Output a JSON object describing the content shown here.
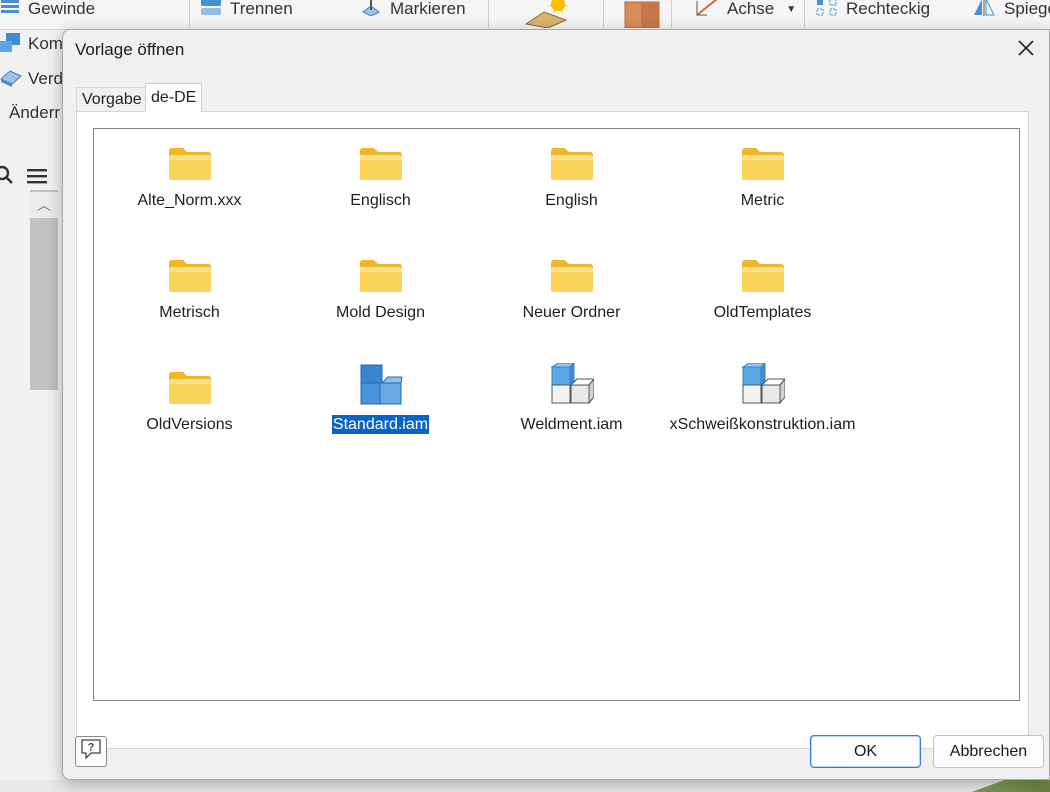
{
  "ribbon": {
    "items": [
      {
        "label": "Gewinde",
        "icon": "thread-icon"
      },
      {
        "label": "Trennen",
        "icon": "split-icon"
      },
      {
        "label": "Markieren",
        "icon": "mark-icon"
      },
      {
        "label": "",
        "icon": "sketch-icon"
      },
      {
        "label": "",
        "icon": "box-icon"
      },
      {
        "label": "Achse",
        "icon": "axis-icon"
      },
      {
        "label": "Rechteckig",
        "icon": "rectangular-pattern-icon"
      },
      {
        "label": "Spiege",
        "icon": "mirror-icon"
      }
    ]
  },
  "left_panel": {
    "items": [
      {
        "label": "Kom",
        "icon": "component-icon"
      },
      {
        "label": "Verd",
        "icon": "thicken-icon"
      },
      {
        "label": "Änderr",
        "icon": ""
      }
    ]
  },
  "dialog": {
    "title": "Vorlage öffnen",
    "tabs": [
      {
        "label": "Vorgabe",
        "active": false
      },
      {
        "label": "de-DE",
        "active": true
      }
    ],
    "files": [
      {
        "name": "Alte_Norm.xxx",
        "type": "folder",
        "selected": false
      },
      {
        "name": "Englisch",
        "type": "folder",
        "selected": false
      },
      {
        "name": "English",
        "type": "folder",
        "selected": false
      },
      {
        "name": "Metric",
        "type": "folder",
        "selected": false
      },
      {
        "name": "Metrisch",
        "type": "folder",
        "selected": false
      },
      {
        "name": "Mold Design",
        "type": "folder",
        "selected": false
      },
      {
        "name": "Neuer Ordner",
        "type": "folder",
        "selected": false
      },
      {
        "name": "OldTemplates",
        "type": "folder",
        "selected": false
      },
      {
        "name": "OldVersions",
        "type": "folder",
        "selected": false
      },
      {
        "name": "Standard.iam",
        "type": "assembly",
        "selected": true
      },
      {
        "name": "Weldment.iam",
        "type": "assembly",
        "selected": false
      },
      {
        "name": "xSchweißkonstruktion.iam",
        "type": "assembly",
        "selected": false
      }
    ],
    "buttons": {
      "ok": "OK",
      "cancel": "Abbrechen"
    },
    "help_icon": "help-icon"
  },
  "colors": {
    "selection": "#0a64c8",
    "folder": "#f9cf48",
    "assembly_blue": "#3c8fd6",
    "ok_border": "#2f7bd8"
  }
}
